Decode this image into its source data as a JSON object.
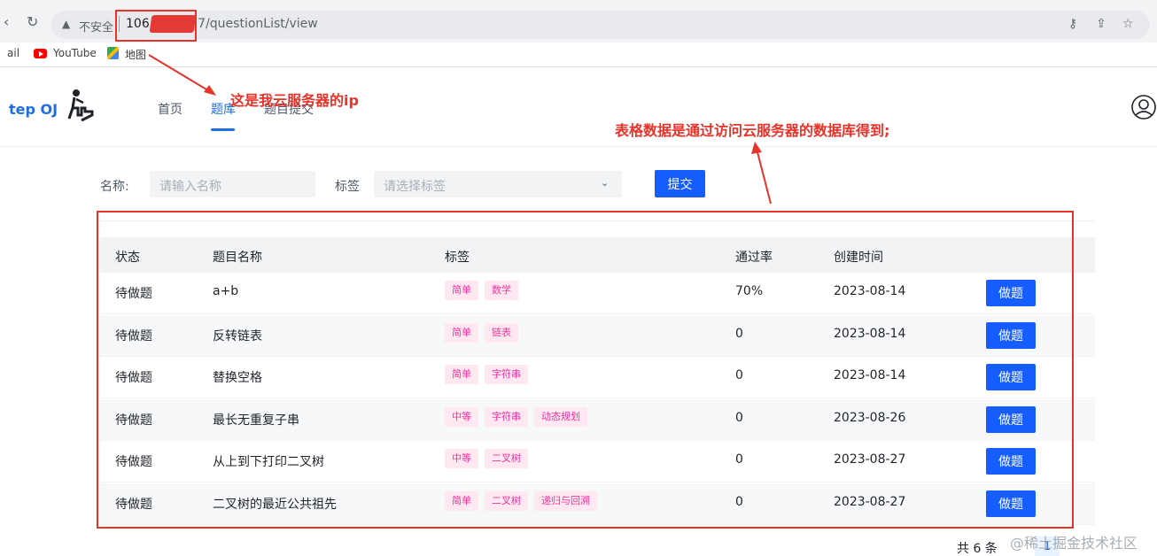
{
  "browser": {
    "insecure_label": "不安全",
    "url_host": "106.",
    "url_path": "7/questionList/view",
    "bookmarks": [
      {
        "label": "ail"
      },
      {
        "label": "YouTube"
      },
      {
        "label": "地图"
      }
    ]
  },
  "app": {
    "brand": "tep OJ",
    "menu": [
      {
        "label": "首页"
      },
      {
        "label": "题库"
      },
      {
        "label": "题目提交"
      }
    ]
  },
  "search": {
    "name_label": "名称:",
    "name_placeholder": "请输入名称",
    "tag_label": "标签",
    "tag_placeholder": "请选择标签",
    "submit_label": "提交"
  },
  "table": {
    "columns": [
      "状态",
      "题目名称",
      "标签",
      "通过率",
      "创建时间"
    ],
    "rows": [
      {
        "status": "待做题",
        "name": "a+b",
        "tags": [
          "简单",
          "数学"
        ],
        "rate": "70%",
        "date": "2023-08-14",
        "action": "做题"
      },
      {
        "status": "待做题",
        "name": "反转链表",
        "tags": [
          "简单",
          "链表"
        ],
        "rate": "0",
        "date": "2023-08-14",
        "action": "做题"
      },
      {
        "status": "待做题",
        "name": "替换空格",
        "tags": [
          "简单",
          "字符串"
        ],
        "rate": "0",
        "date": "2023-08-14",
        "action": "做题"
      },
      {
        "status": "待做题",
        "name": "最长无重复子串",
        "tags": [
          "中等",
          "字符串",
          "动态规划"
        ],
        "rate": "0",
        "date": "2023-08-26",
        "action": "做题"
      },
      {
        "status": "待做题",
        "name": "从上到下打印二叉树",
        "tags": [
          "中等",
          "二叉树"
        ],
        "rate": "0",
        "date": "2023-08-27",
        "action": "做题"
      },
      {
        "status": "待做题",
        "name": "二叉树的最近公共祖先",
        "tags": [
          "简单",
          "二叉树",
          "递归与回溯"
        ],
        "rate": "0",
        "date": "2023-08-27",
        "action": "做题"
      }
    ]
  },
  "pagination": {
    "total": "共 6 条",
    "current": "1"
  },
  "annotations": {
    "ip_note": "这是我云服务器的ip",
    "table_note": "表格数据是通过访问云服务器的数据库得到;"
  },
  "watermark": "@稀土掘金技术社区",
  "colors": {
    "primary": "#165dff",
    "annotation": "#e8332a",
    "tag_text": "#f5319d",
    "tag_bg": "#ffe8f1"
  }
}
